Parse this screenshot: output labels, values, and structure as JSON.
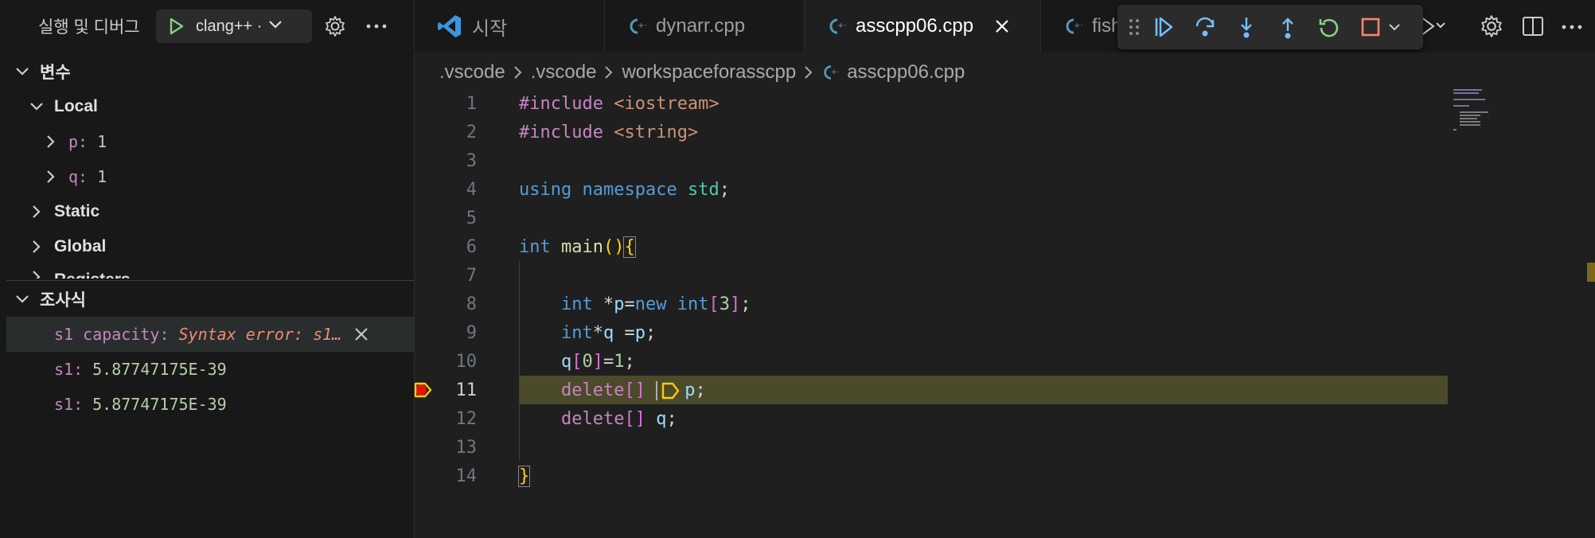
{
  "sidebar": {
    "title": "실행 및 디버그",
    "run_config": "clang++ ·",
    "variables": {
      "header": "변수",
      "local_label": "Local",
      "locals": [
        {
          "name": "p:",
          "value": "1"
        },
        {
          "name": "q:",
          "value": "1"
        }
      ],
      "static_label": "Static",
      "global_label": "Global",
      "registers_label": "Registers"
    },
    "watch": {
      "header": "조사식",
      "items": [
        {
          "name": "s1 capacity:",
          "value": "Syntax error: s1…"
        },
        {
          "name": "s1:",
          "value": "5.87747175E-39"
        },
        {
          "name": "s1:",
          "value": "5.87747175E-39"
        }
      ]
    }
  },
  "tabs": [
    {
      "label": "시작",
      "icon": "vscode-logo-icon"
    },
    {
      "label": "dynarr.cpp",
      "icon": "cpp-file-icon"
    },
    {
      "label": "asscpp06.cpp",
      "icon": "cpp-file-icon",
      "active": true
    },
    {
      "label": "fish",
      "icon": "cpp-file-icon"
    }
  ],
  "breadcrumb": [
    ".vscode",
    ".vscode",
    "workspaceforasscpp",
    "asscpp06.cpp"
  ],
  "editor": {
    "current_line": 11,
    "lines": [
      {
        "n": "1"
      },
      {
        "n": "2"
      },
      {
        "n": "3"
      },
      {
        "n": "4"
      },
      {
        "n": "5"
      },
      {
        "n": "6"
      },
      {
        "n": "7"
      },
      {
        "n": "8"
      },
      {
        "n": "9"
      },
      {
        "n": "10"
      },
      {
        "n": "11"
      },
      {
        "n": "12"
      },
      {
        "n": "13"
      },
      {
        "n": "14"
      }
    ],
    "code": {
      "l1": {
        "kw": "#include",
        "str": "<iostream>"
      },
      "l2": {
        "kw": "#include",
        "str": "<string>"
      },
      "l4": {
        "a": "using",
        "b": "namespace",
        "c": "std",
        "d": ";"
      },
      "l6": {
        "a": "int",
        "b": "main",
        "c": "()",
        "d": "{"
      },
      "l8": {
        "a": "int",
        "b": " *",
        "c": "p",
        "d": "=",
        "e": "new",
        "f": " int",
        "g": "[",
        "h": "3",
        "i": "]",
        "j": ";"
      },
      "l9": {
        "a": "int",
        "b": "*",
        "c": "q",
        "d": " =",
        "e": "p",
        "f": ";"
      },
      "l10": {
        "a": "q",
        "b": "[",
        "c": "0",
        "d": "]",
        "e": "=",
        "f": "1",
        "g": ";"
      },
      "l11": {
        "a": "delete",
        "b": "[]",
        "c": "p",
        "d": ";"
      },
      "l12": {
        "a": "delete",
        "b": "[]",
        "c": "q",
        "d": ";"
      },
      "l14": {
        "a": "}"
      }
    }
  },
  "colors": {
    "keyword": "#569cd6",
    "preproc": "#c586c0",
    "string": "#ce9178",
    "type": "#4ec9b0",
    "function": "#dcdcaa",
    "number": "#b5cea8",
    "variable": "#9cdcfe",
    "highlight": "#4b4a2a",
    "breakpoint": "#e2c08d"
  }
}
